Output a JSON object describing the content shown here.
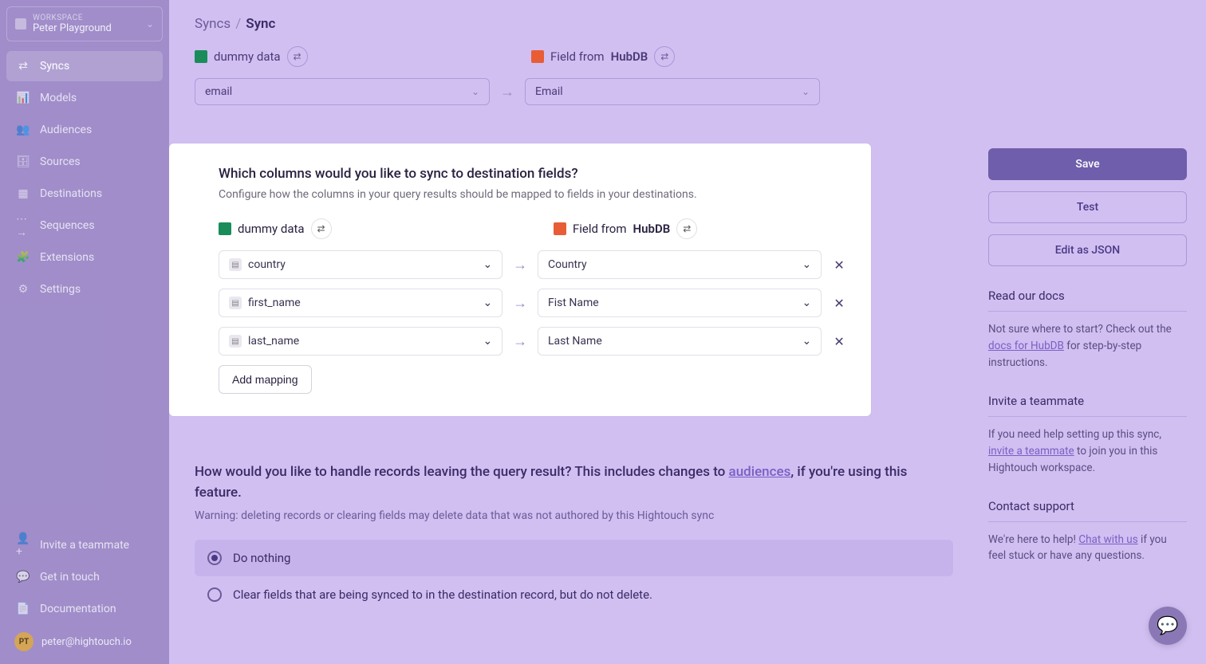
{
  "workspace": {
    "label": "WORKSPACE",
    "name": "Peter Playground"
  },
  "nav": [
    {
      "label": "Syncs",
      "icon": "⇄",
      "active": true
    },
    {
      "label": "Models",
      "icon": "📊"
    },
    {
      "label": "Audiences",
      "icon": "👥"
    },
    {
      "label": "Sources",
      "icon": "🗄"
    },
    {
      "label": "Destinations",
      "icon": "▦"
    },
    {
      "label": "Sequences",
      "icon": "⋯→"
    },
    {
      "label": "Extensions",
      "icon": "🧩"
    },
    {
      "label": "Settings",
      "icon": "⚙"
    }
  ],
  "sidebar_bottom": [
    {
      "label": "Invite a teammate",
      "icon": "👤+"
    },
    {
      "label": "Get in touch",
      "icon": "💬"
    },
    {
      "label": "Documentation",
      "icon": "📄"
    }
  ],
  "user": {
    "initials": "PT",
    "email": "peter@hightouch.io"
  },
  "breadcrumb": {
    "parent": "Syncs",
    "current": "Sync"
  },
  "top_mapping": {
    "source_label": "dummy data",
    "dest_prefix": "Field from",
    "dest_name": "HubDB",
    "left_value": "email",
    "right_value": "Email"
  },
  "card": {
    "title": "Which columns would you like to sync to destination fields?",
    "subtitle": "Configure how the columns in your query results should be mapped to fields in your destinations.",
    "source_label": "dummy data",
    "dest_prefix": "Field from",
    "dest_name": "HubDB",
    "rows": [
      {
        "src": "country",
        "dst": "Country"
      },
      {
        "src": "first_name",
        "dst": "Fist Name"
      },
      {
        "src": "last_name",
        "dst": "Last Name"
      }
    ],
    "add_label": "Add mapping"
  },
  "records_section": {
    "question_a": "How would you like to handle records leaving the query result? This includes changes to ",
    "audiences_link": "audiences",
    "question_b": ", if you're using this feature.",
    "warning": "Warning: deleting records or clearing fields may delete data that was not authored by this Hightouch sync",
    "options": [
      {
        "label": "Do nothing",
        "selected": true
      },
      {
        "label": "Clear fields that are being synced to in the destination record, but do not delete.",
        "selected": false
      }
    ]
  },
  "actions": {
    "save": "Save",
    "test": "Test",
    "edit_json": "Edit as JSON"
  },
  "docs": {
    "title": "Read our docs",
    "text_a": "Not sure where to start? Check out the ",
    "link": "docs for HubDB",
    "text_b": " for step-by-step instructions."
  },
  "invite": {
    "title": "Invite a teammate",
    "text_a": "If you need help setting up this sync, ",
    "link": "invite a teammate",
    "text_b": " to join you in this Hightouch workspace."
  },
  "support": {
    "title": "Contact support",
    "text_a": "We're here to help! ",
    "link": "Chat with us",
    "text_b": " if you feel stuck or have any questions."
  }
}
